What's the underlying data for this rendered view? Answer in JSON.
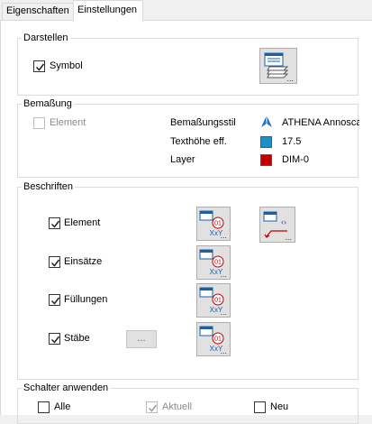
{
  "tabs": [
    {
      "label": "Eigenschaften",
      "active": false
    },
    {
      "label": "Einstellungen",
      "active": true
    }
  ],
  "darstellen": {
    "title": "Darstellen",
    "symbol": {
      "label": "Symbol",
      "checked": true
    }
  },
  "bemassung": {
    "title": "Bemaßung",
    "element": {
      "label": "Element",
      "checked": false,
      "enabled": false
    },
    "stil_label": "Bemaßungsstil",
    "stil_value": "ATHENA Annoscal",
    "texthoehe_label": "Texthöhe eff.",
    "texthoehe_value": "17.5",
    "texthoehe_color": "#1f8ec8",
    "layer_label": "Layer",
    "layer_value": "DIM-0",
    "layer_color": "#c00000"
  },
  "beschriften": {
    "title": "Beschriften",
    "items": [
      {
        "label": "Element",
        "checked": true
      },
      {
        "label": "Einsätze",
        "checked": true
      },
      {
        "label": "Füllungen",
        "checked": true
      },
      {
        "label": "Stäbe",
        "checked": true
      }
    ],
    "label_icon_text": {
      "num": "01",
      "xy": "XxY"
    },
    "more_button_label": "...",
    "ellipsis": "..."
  },
  "schalter": {
    "title": "Schalter anwenden",
    "alle": {
      "label": "Alle",
      "checked": false
    },
    "aktuell": {
      "label": "Aktuell",
      "checked": true,
      "enabled": false
    },
    "neu": {
      "label": "Neu",
      "checked": false
    }
  }
}
